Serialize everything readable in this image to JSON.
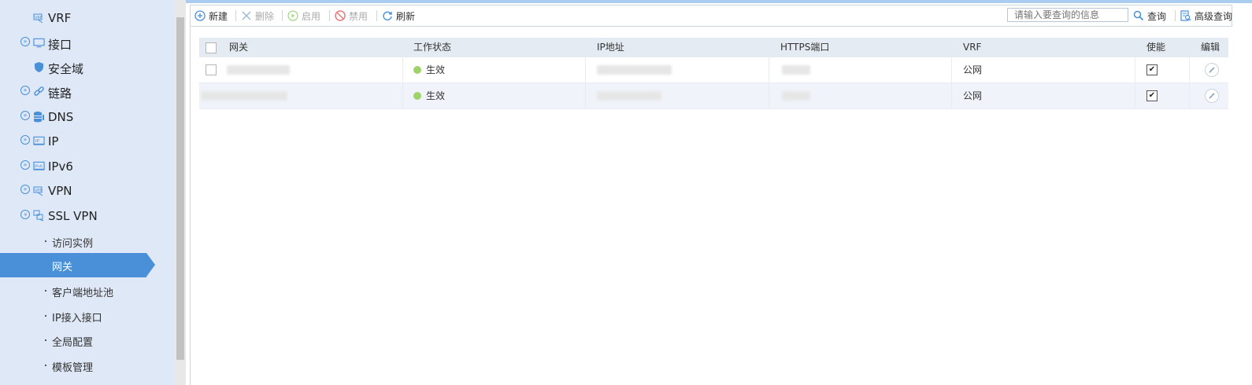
{
  "sidebar": {
    "items": [
      {
        "label": "VRF",
        "icon": "vrf-icon",
        "expandable": false
      },
      {
        "label": "接口",
        "icon": "monitor-icon",
        "expandable": true
      },
      {
        "label": "安全域",
        "icon": "shield-icon",
        "expandable": false
      },
      {
        "label": "链路",
        "icon": "link-icon",
        "expandable": true
      },
      {
        "label": "DNS",
        "icon": "database-icon",
        "expandable": true
      },
      {
        "label": "IP",
        "icon": "ip-icon",
        "expandable": true
      },
      {
        "label": "IPv6",
        "icon": "ipv6-icon",
        "expandable": true
      },
      {
        "label": "VPN",
        "icon": "vpn-icon",
        "expandable": true
      },
      {
        "label": "SSL VPN",
        "icon": "ssl-vpn-icon",
        "expandable": true,
        "expanded": true
      }
    ],
    "subitems": [
      {
        "label": "访问实例",
        "active": false
      },
      {
        "label": "网关",
        "active": true
      },
      {
        "label": "客户端地址池",
        "active": false
      },
      {
        "label": "IP接入接口",
        "active": false
      },
      {
        "label": "全局配置",
        "active": false
      },
      {
        "label": "模板管理",
        "active": false
      }
    ]
  },
  "toolbar": {
    "new_label": "新建",
    "delete_label": "删除",
    "enable_label": "启用",
    "disable_label": "禁用",
    "refresh_label": "刷新",
    "search_placeholder": "请输入要查询的信息",
    "query_label": "查询",
    "advanced_query_label": "高级查询"
  },
  "table": {
    "columns": [
      "网关",
      "工作状态",
      "IP地址",
      "HTTPS端口",
      "VRF",
      "使能",
      "编辑"
    ],
    "rows": [
      {
        "status": "生效",
        "vrf": "公网",
        "enabled": true
      },
      {
        "status": "生效",
        "vrf": "公网",
        "enabled": true
      }
    ]
  },
  "colors": {
    "accent": "#4a90d9",
    "sidebar_bg": "#dfe8f6",
    "status_active": "#9ed36a"
  }
}
